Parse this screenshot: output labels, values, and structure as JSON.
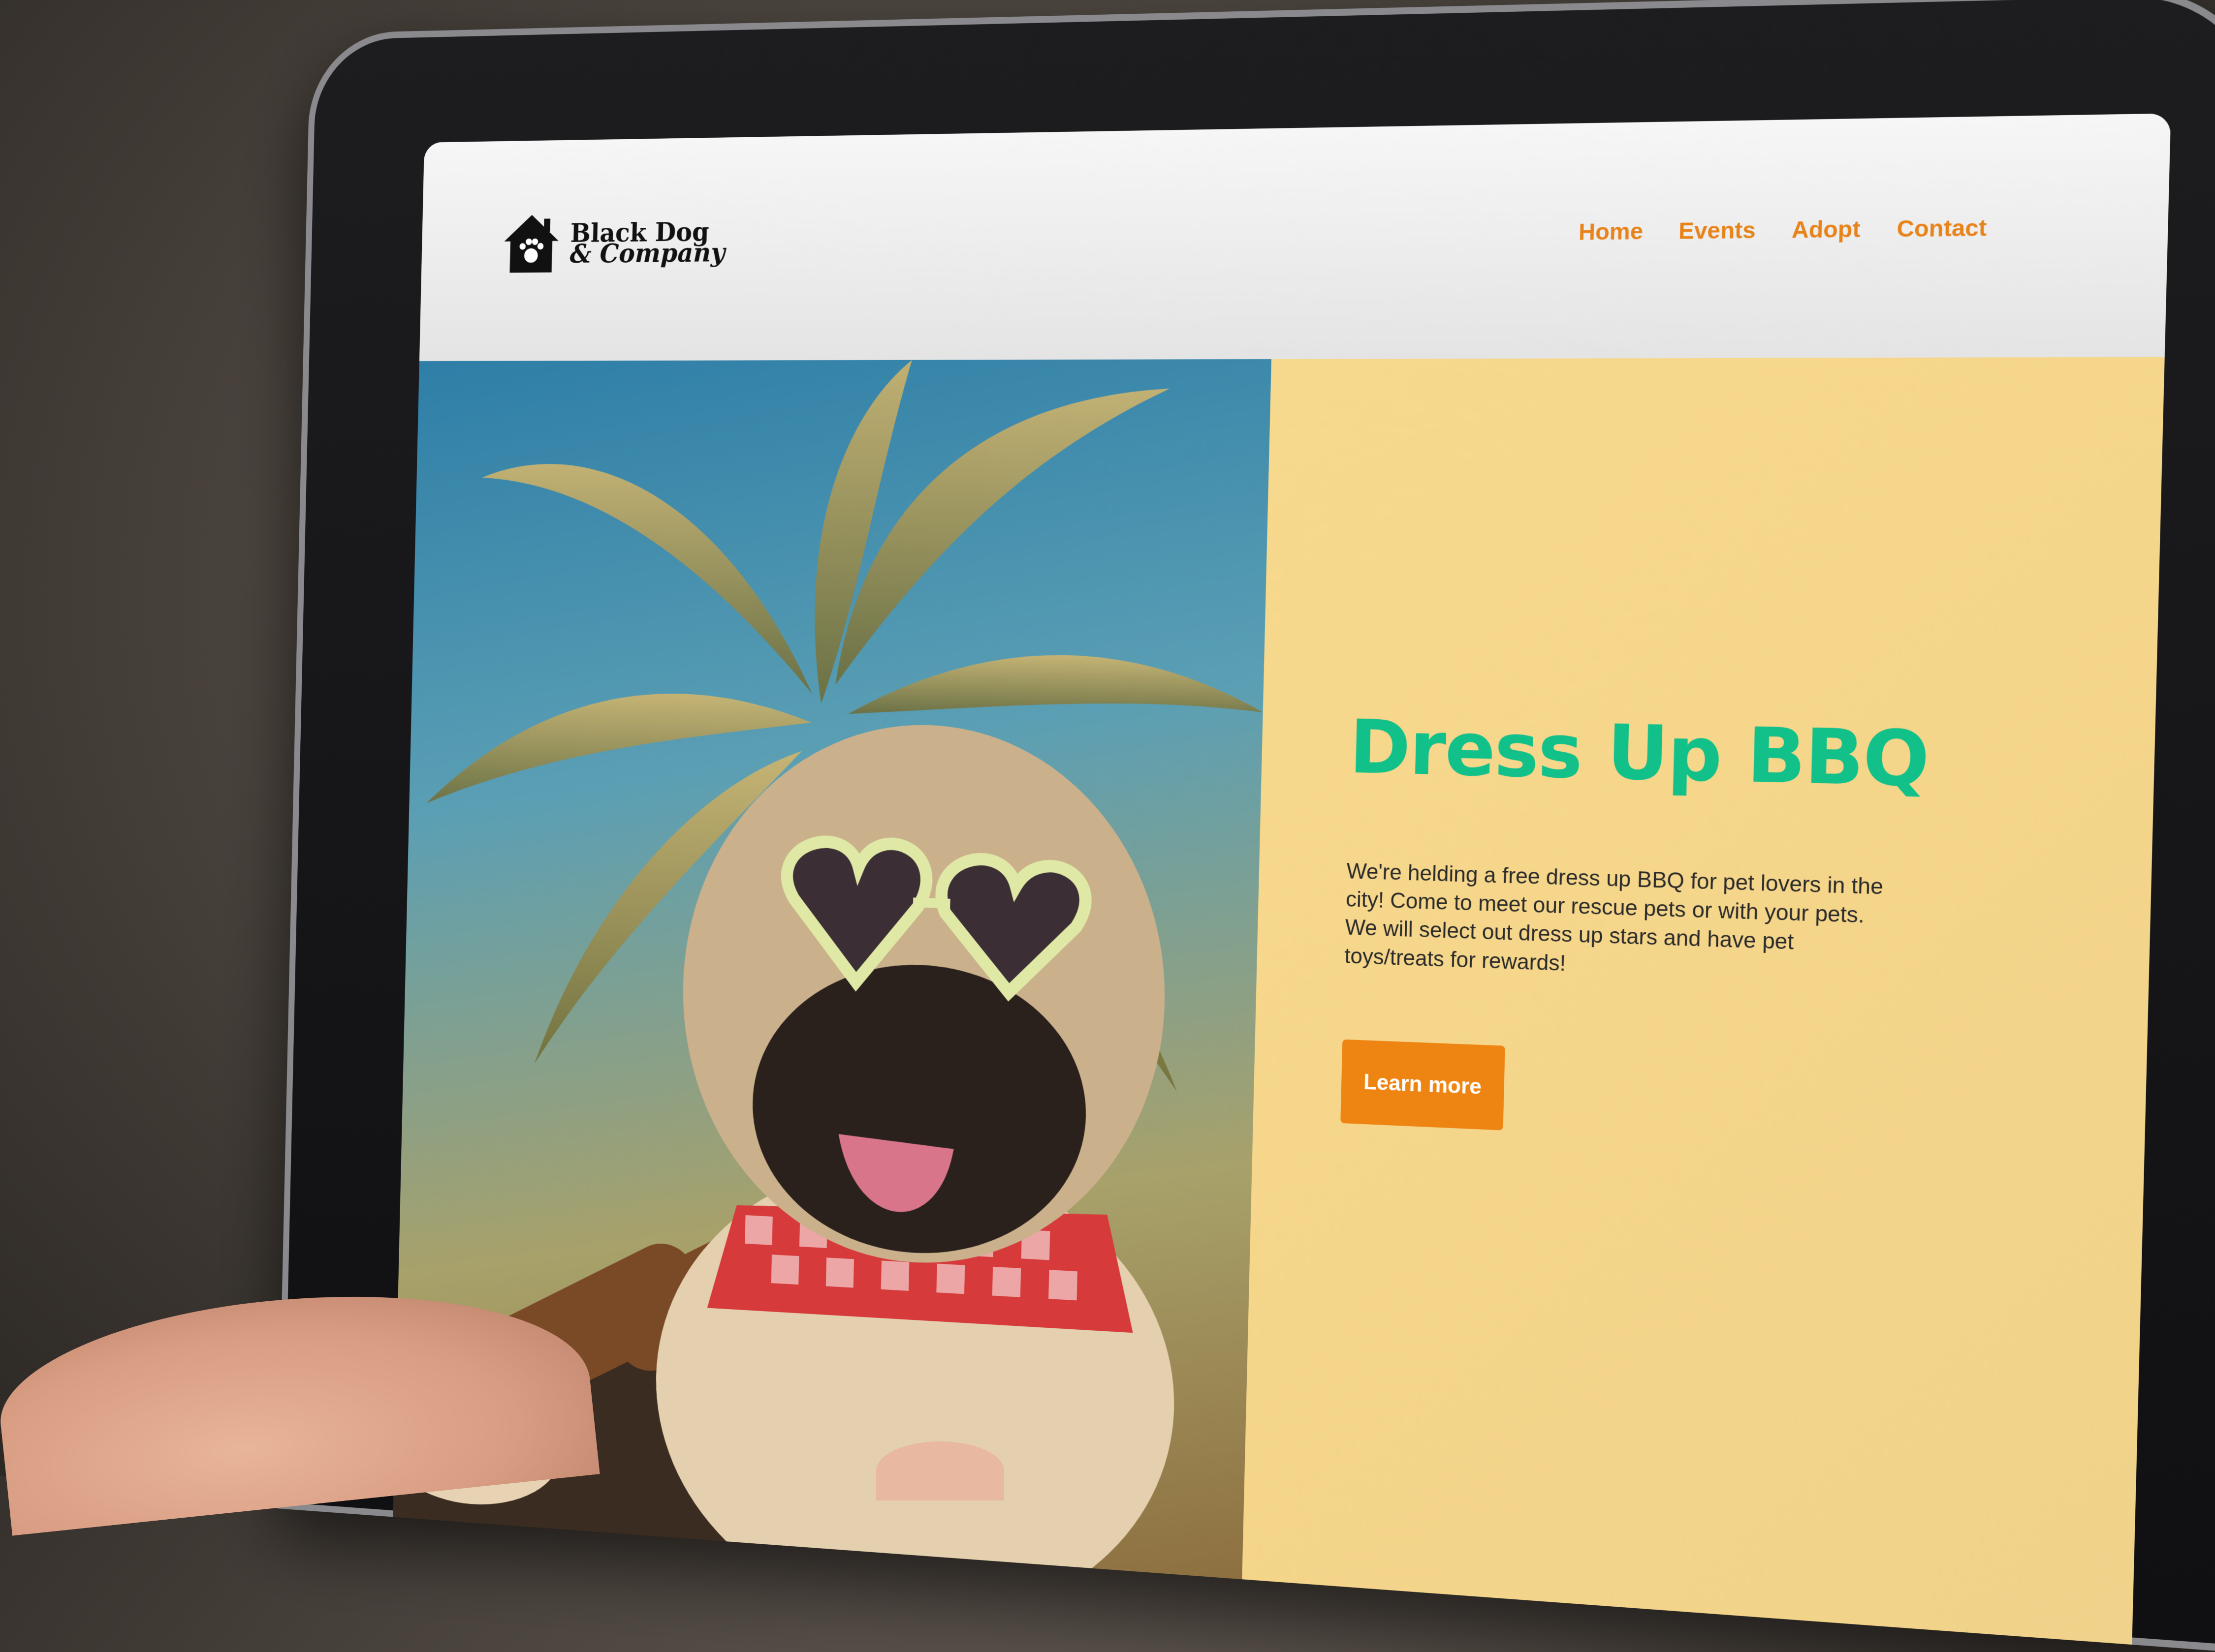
{
  "site": {
    "logo": {
      "line1": "Black Dog",
      "line2": "& Company",
      "icon": "house-paw-icon"
    },
    "nav": {
      "items": [
        {
          "label": "Home"
        },
        {
          "label": "Events"
        },
        {
          "label": "Adopt"
        },
        {
          "label": "Contact"
        }
      ]
    }
  },
  "hero": {
    "title": "Dress Up BBQ",
    "description": "We're helding a free dress up BBQ for pet lovers in the city! Come to meet our rescue pets or with your pets. We will select out dress up stars and have pet toys/treats for rewards!",
    "cta_label": "Learn more",
    "image": "pug-with-heart-sunglasses-and-sausages"
  },
  "colors": {
    "accent": "#e8831a",
    "title": "#12c08a",
    "panel": "#f5d68a",
    "button": "#ee8512"
  }
}
